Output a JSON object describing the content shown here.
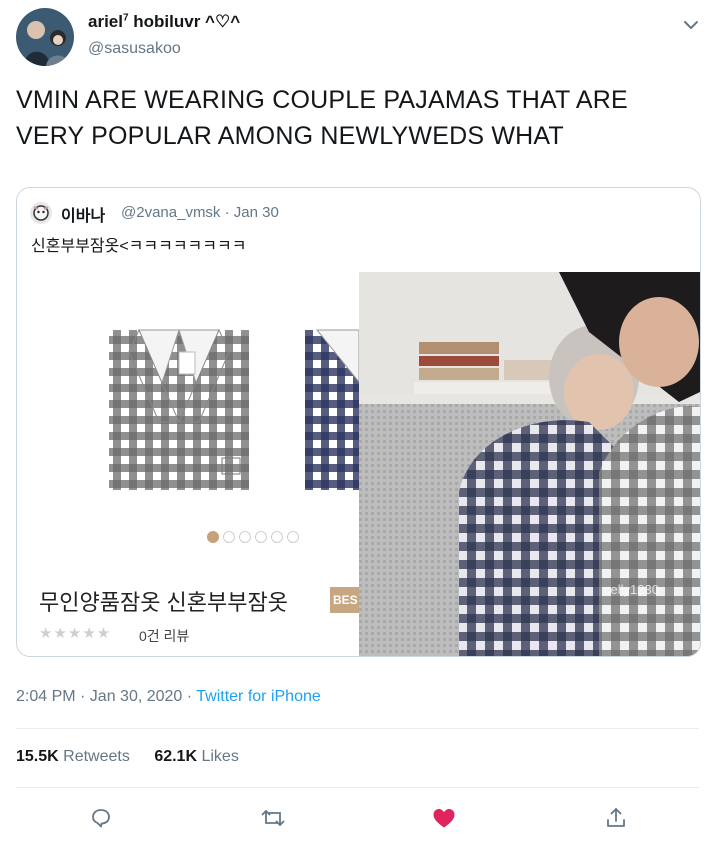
{
  "author": {
    "name": "ariel",
    "name_sup": "7",
    "name_suffix": " hobiluvr ^♡^",
    "handle": "@sasusakoo"
  },
  "tweet_text": "VMIN ARE WEARING COUPLE PAJAMAS THAT ARE VERY POPULAR AMONG NEWLYWEDS WHAT",
  "quote": {
    "name": "이바나",
    "handle_date": "@2vana_vmsk · Jan 30",
    "text": "신혼부부잠옷<ㅋㅋㅋㅋㅋㅋㅋㅋ",
    "product_title": "무인양품잠옷 신혼부부잠옷",
    "badge": "BES",
    "stars": "★★★★★",
    "review_count": "0건 리뷰",
    "carousel": {
      "count": 6,
      "active_index": 0
    },
    "photo_watermark": "celly1230"
  },
  "meta": {
    "time_date": "2:04 PM · Jan 30, 2020 · ",
    "source": "Twitter for iPhone"
  },
  "stats": {
    "retweets_count": "15.5K",
    "retweets_label": "Retweets",
    "likes_count": "62.1K",
    "likes_label": "Likes"
  },
  "colors": {
    "accent": "#1da1f2",
    "like": "#e0245e",
    "muted": "#657786",
    "border": "#ccd6dd"
  },
  "icons": [
    "chevron-down-icon",
    "reply-icon",
    "retweet-icon",
    "heart-icon",
    "share-icon"
  ]
}
